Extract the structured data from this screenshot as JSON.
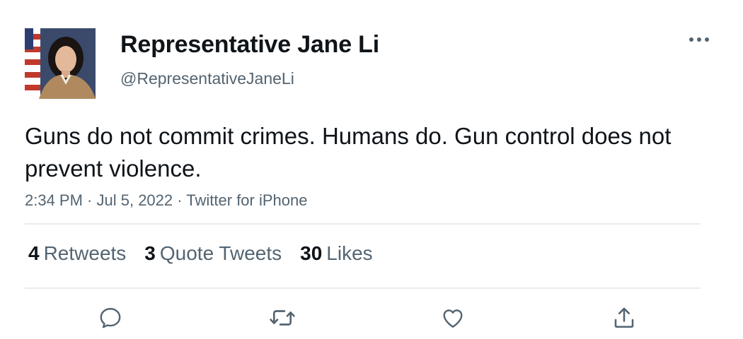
{
  "author": {
    "display_name": "Representative Jane Li",
    "handle": "@RepresentativeJaneLi",
    "avatar_icon": "profile-photo"
  },
  "tweet": {
    "text": "Guns do not commit crimes. Humans do. Gun control does not prevent violence.",
    "time": "2:34 PM",
    "date": "Jul 5, 2022",
    "source": "Twitter for iPhone",
    "separator": " · "
  },
  "stats": {
    "retweets": {
      "count": "4",
      "label": "Retweets"
    },
    "quote_tweets": {
      "count": "3",
      "label": "Quote Tweets"
    },
    "likes": {
      "count": "30",
      "label": "Likes"
    }
  },
  "actions": {
    "reply_icon": "reply-icon",
    "retweet_icon": "retweet-icon",
    "like_icon": "heart-icon",
    "share_icon": "share-icon",
    "more_icon": "more-icon"
  },
  "colors": {
    "text_primary": "#0f1419",
    "text_secondary": "#536471",
    "divider": "#e6ecf0"
  }
}
